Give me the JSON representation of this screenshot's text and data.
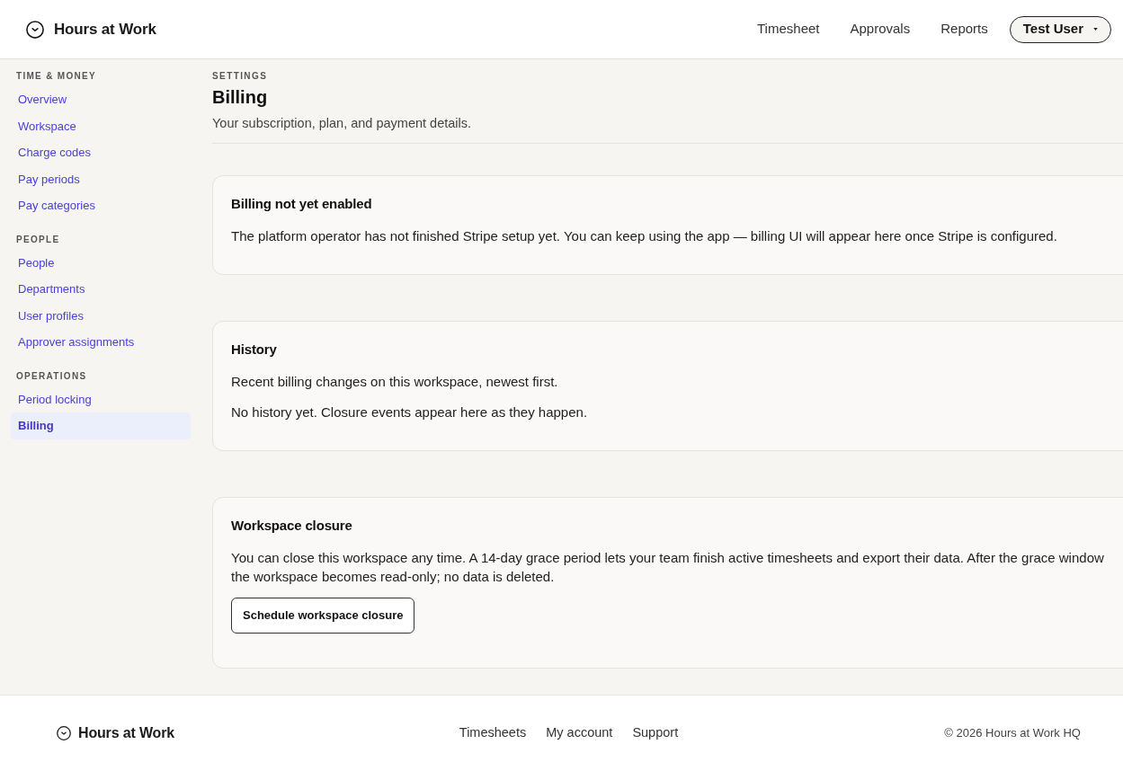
{
  "header": {
    "brand": "Hours at Work",
    "nav": [
      "Timesheet",
      "Approvals",
      "Reports"
    ],
    "user_menu": {
      "label": "Test User"
    }
  },
  "sidebar": {
    "sections": [
      {
        "heading": "TIME & MONEY",
        "items": [
          {
            "label": "Overview",
            "selected": false
          },
          {
            "label": "Workspace",
            "selected": false
          },
          {
            "label": "Charge codes",
            "selected": false
          },
          {
            "label": "Pay periods",
            "selected": false
          },
          {
            "label": "Pay categories",
            "selected": false
          }
        ]
      },
      {
        "heading": "PEOPLE",
        "items": [
          {
            "label": "People",
            "selected": false
          },
          {
            "label": "Departments",
            "selected": false
          },
          {
            "label": "User profiles",
            "selected": false
          },
          {
            "label": "Approver assignments",
            "selected": false
          }
        ]
      },
      {
        "heading": "OPERATIONS",
        "items": [
          {
            "label": "Period locking",
            "selected": false
          },
          {
            "label": "Billing",
            "selected": true
          }
        ]
      }
    ]
  },
  "page": {
    "eyebrow": "SETTINGS",
    "title": "Billing",
    "subtitle": "Your subscription, plan, and payment details."
  },
  "cards": [
    {
      "title": "Billing not yet enabled",
      "paragraphs": [
        "The platform operator has not finished Stripe setup yet. You can keep using the app — billing UI will appear here once Stripe is configured."
      ]
    },
    {
      "title": "History",
      "paragraphs": [
        "Recent billing changes on this workspace, newest first.",
        "No history yet. Closure events appear here as they happen."
      ]
    },
    {
      "title": "Workspace closure",
      "paragraphs": [
        "You can close this workspace any time. A 14-day grace period lets your team finish active timesheets and export their data. After the grace window the workspace becomes read-only; no data is deleted."
      ],
      "button": "Schedule workspace closure"
    }
  ],
  "footer": {
    "brand": "Hours at Work",
    "links": [
      "Timesheets",
      "My account",
      "Support"
    ],
    "copyright": "© 2026 Hours at Work HQ"
  }
}
